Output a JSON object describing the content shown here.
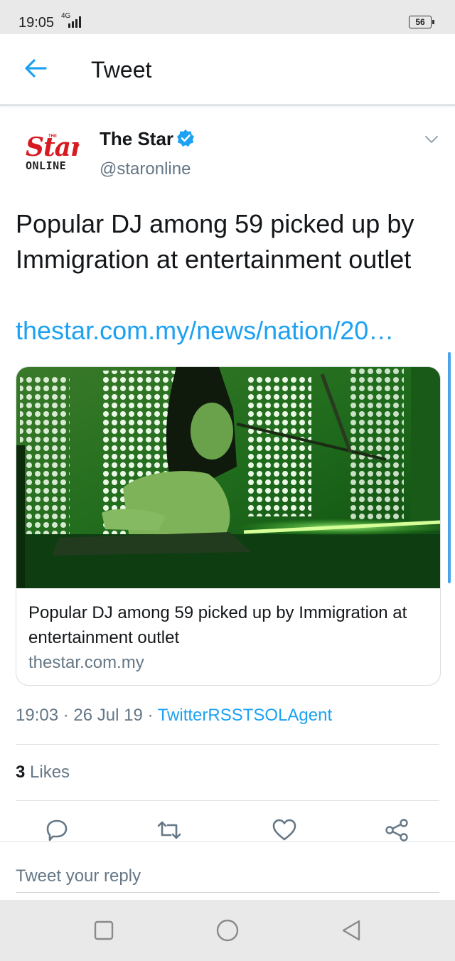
{
  "status_bar": {
    "time": "19:05",
    "network": "4G",
    "battery": "56"
  },
  "header": {
    "title": "Tweet",
    "back_icon": "arrow-left-icon"
  },
  "tweet": {
    "author": {
      "name": "The Star",
      "handle": "@staronline",
      "verified": true,
      "avatar_logo": {
        "top": "THE",
        "main": "Star",
        "bottom": "ONLINE"
      }
    },
    "text": "Popular DJ among 59 picked up by Immigration at entertainment outlet",
    "link": "thestar.com.my/news/nation/20…",
    "card": {
      "title": "Popular DJ among 59 picked up by Immigration at entertainment outlet",
      "domain": "thestar.com.my"
    },
    "time": "19:03",
    "date": "26 Jul 19",
    "source": "TwitterRSSTSOLAgent",
    "separator": "·",
    "likes_count": "3",
    "likes_label": "Likes"
  },
  "actions": [
    "reply-icon",
    "retweet-icon",
    "like-icon",
    "share-icon"
  ],
  "reply": {
    "placeholder": "Tweet your reply"
  },
  "colors": {
    "accent": "#1da1f2",
    "muted": "#657786",
    "text": "#14171a",
    "brand_red": "#d71920"
  }
}
